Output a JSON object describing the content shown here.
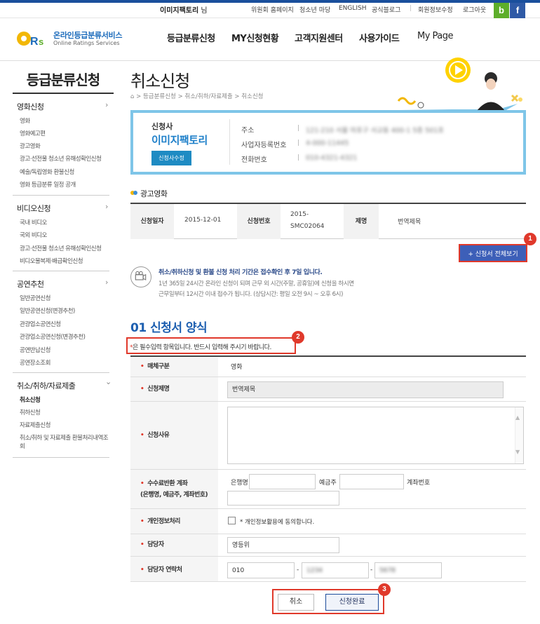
{
  "util": {
    "user_name": "이미지팩토리",
    "user_suffix": "님",
    "links": [
      "위원회 홈페이지",
      "청소년 마당",
      "ENGLISH",
      "공식블로그"
    ],
    "account_links": [
      "회원정보수정",
      "로그아웃"
    ],
    "sns": [
      "b",
      "f"
    ]
  },
  "logo": {
    "kr": "온라인등급분류서비스",
    "en": "Online Ratings Services",
    "mark": "ORs"
  },
  "gnb": [
    "등급분류신청",
    "MY신청현황",
    "고객지원센터",
    "사용가이드",
    "My Page"
  ],
  "sidebar": {
    "title": "등급분류신청",
    "groups": [
      {
        "label": "영화신청",
        "arrow": "›",
        "items": [
          "영화",
          "영화예고편",
          "광고영화",
          "광고·선전물 청소년 유해성확인신청",
          "예술/독립영화 환불신청",
          "영화 등급분류 일정 공개"
        ]
      },
      {
        "label": "비디오신청",
        "arrow": "›",
        "items": [
          "국내 비디오",
          "국외 비디오",
          "광고·선전물 청소년 유해성확인신청",
          "비디오물복제·배급확인신청"
        ]
      },
      {
        "label": "공연추천",
        "arrow": "›",
        "items": [
          "일반공연신청",
          "일반공연신청(변경추천)",
          "관광업소공연신청",
          "관광업소공연신청(변경추천)",
          "공연반납신청",
          "공연장소조회"
        ]
      },
      {
        "label": "취소/취하/자료제출",
        "arrow": "⌄",
        "items": [
          "취소신청",
          "취하신청",
          "자료제출신청",
          "취소/취하 및 자료제출 환불처리내역조회"
        ]
      }
    ]
  },
  "page": {
    "title": "취소신청",
    "breadcrumb": [
      "등급분류신청",
      "취소/취하/자료제출",
      "취소신청"
    ],
    "breadcrumb_sep": ">"
  },
  "applicant": {
    "label": "신청사",
    "name": "이미지팩토리",
    "edit_button": "신청사수정",
    "fields": [
      {
        "key": "주소",
        "value": "121-210 서울 마포구 서교동 400-1 5층 501호"
      },
      {
        "key": "사업자등록번호",
        "value": "4-000-11445"
      },
      {
        "key": "전화번호",
        "value": "010-4321-4321"
      }
    ],
    "pipe": "|"
  },
  "ad_section": {
    "title": "광고영화",
    "row": {
      "date_label": "신청일자",
      "date": "2015-12-01",
      "no_label": "신청번호",
      "no_line1": "2015-",
      "no_line2": "SMC02064",
      "title_label": "제명",
      "title_value": "번역제목"
    }
  },
  "view_full_button": "+ 신청서 전체보기",
  "badges": [
    "1",
    "2",
    "3"
  ],
  "notice": {
    "bold": "취소/취하신청 및 환불 신청 처리 기간은 접수확인 후 7일 입니다.",
    "line1": "1년 365일 24시간 온라인 신청이 되며 근무 외 시간(주말, 공휴일)에 신청을 하시면",
    "line2": "근무일부터 12시간 이내 접수가 됩니다. (상담시간: 평일 오전 9시 ~ 오후 6시)"
  },
  "form": {
    "title": "01 신청서 양식",
    "required_star": "*",
    "required_notice": "은 필수입력 항목입니다. 반드시 입력해 주시기 바랍니다.",
    "star": "•",
    "media_label": "매체구분",
    "media_value": "영화",
    "app_title_label": "신청제명",
    "app_title_value": "번역제목",
    "reason_label": "신청사유",
    "refund_label_1": "수수료반환 계좌",
    "refund_label_2": "(은행명, 예금주, 계좌번호)",
    "bank_label": "은행명",
    "holder_label": "예금주",
    "account_label": "계좌번호",
    "privacy_label": "개인정보처리",
    "privacy_text": "* 개인정보활용에 동의합니다.",
    "manager_label": "담당자",
    "manager_value": "영등위",
    "contact_label": "담당자 연락처",
    "phone1": "010",
    "phone2": "1234",
    "phone3": "5678",
    "phone_sep": "-"
  },
  "buttons": {
    "cancel": "취소",
    "submit": "신청완료"
  },
  "colors": {
    "accent": "#1d5fb0",
    "highlight": "#e0392b",
    "box_border": "#7ec5e8",
    "button_blue": "#3d5fb8"
  }
}
